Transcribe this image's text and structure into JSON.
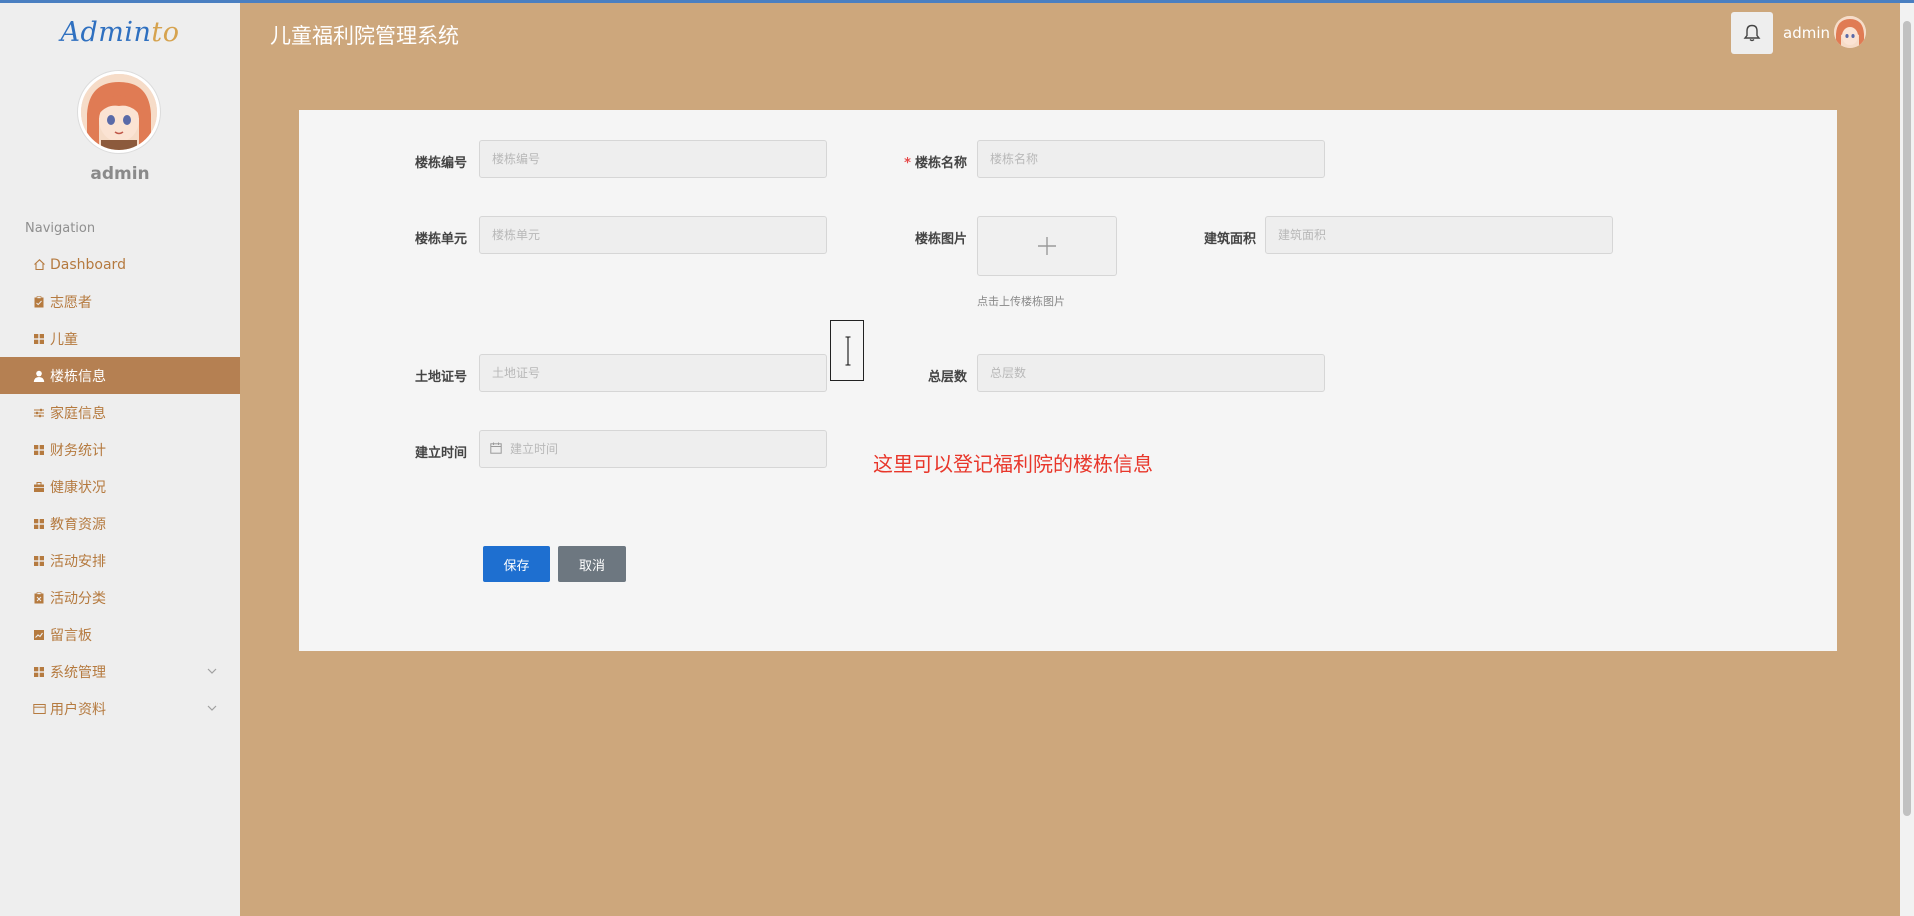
{
  "app": {
    "brand_main": "Admin",
    "brand_accent": "to",
    "title": "儿童福利院管理系统",
    "user": "admin"
  },
  "sidebar": {
    "username": "admin",
    "nav_title": "Navigation",
    "items": [
      {
        "label": "Dashboard",
        "icon": "home-icon"
      },
      {
        "label": "志愿者",
        "icon": "clipboard-icon"
      },
      {
        "label": "儿童",
        "icon": "grid-icon"
      },
      {
        "label": "楼栋信息",
        "icon": "user-icon",
        "active": true
      },
      {
        "label": "家庭信息",
        "icon": "sliders-icon"
      },
      {
        "label": "财务统计",
        "icon": "grid-icon"
      },
      {
        "label": "健康状况",
        "icon": "briefcase-icon"
      },
      {
        "label": "教育资源",
        "icon": "grid-icon"
      },
      {
        "label": "活动安排",
        "icon": "grid-icon"
      },
      {
        "label": "活动分类",
        "icon": "clipboard-x-icon"
      },
      {
        "label": "留言板",
        "icon": "chart-icon"
      },
      {
        "label": "系统管理",
        "icon": "grid-icon",
        "expandable": true
      },
      {
        "label": "用户资料",
        "icon": "id-card-icon",
        "expandable": true
      }
    ]
  },
  "form": {
    "building_no": {
      "label": "楼栋编号",
      "placeholder": "楼栋编号",
      "value": ""
    },
    "building_name": {
      "label": "楼栋名称",
      "placeholder": "楼栋名称",
      "value": "",
      "required": true
    },
    "building_unit": {
      "label": "楼栋单元",
      "placeholder": "楼栋单元",
      "value": ""
    },
    "building_image": {
      "label": "楼栋图片",
      "hint": "点击上传楼栋图片"
    },
    "building_area": {
      "label": "建筑面积",
      "placeholder": "建筑面积",
      "value": ""
    },
    "land_cert": {
      "label": "土地证号",
      "placeholder": "土地证号",
      "value": ""
    },
    "total_floors": {
      "label": "总层数",
      "placeholder": "总层数",
      "value": ""
    },
    "build_time": {
      "label": "建立时间",
      "placeholder": "建立时间",
      "value": ""
    },
    "required_mark": "*",
    "save_label": "保存",
    "cancel_label": "取消"
  },
  "annotation": "这里可以登记福利院的楼栋信息",
  "colors": {
    "background": "#cda77c",
    "sidebar_bg": "#eeeeee",
    "active_item": "#b58052",
    "nav_text": "#b57a3f",
    "save_button": "#1e6fd0",
    "cancel_button": "#6d7780",
    "annotation": "#e8362a",
    "brand": "#2f70c0"
  }
}
